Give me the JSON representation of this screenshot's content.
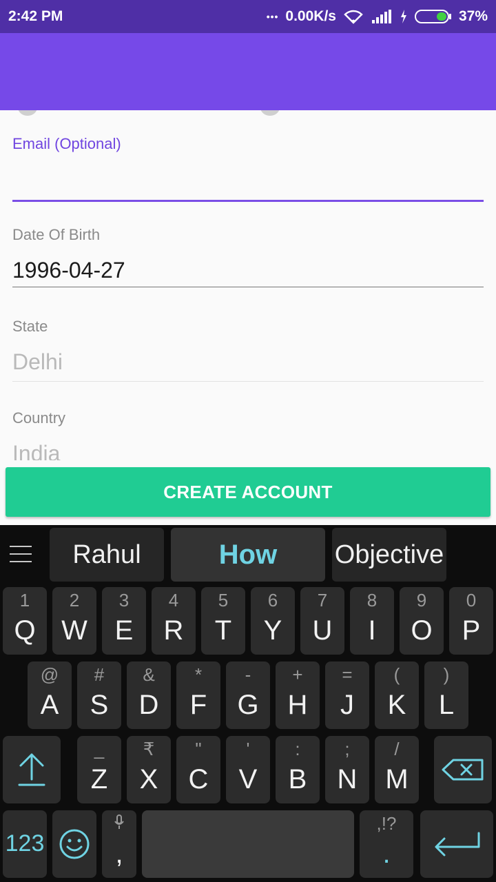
{
  "status_bar": {
    "time": "2:42 PM",
    "dots": "•••",
    "network_speed": "0.00K/s",
    "battery": "37%",
    "colors": {
      "background": "#4f2fa6"
    }
  },
  "app_bar": {
    "color": "#7649e8"
  },
  "form": {
    "email": {
      "label": "Email (Optional)",
      "value": ""
    },
    "dob": {
      "label": "Date Of Birth",
      "value": "1996-04-27"
    },
    "state": {
      "label": "State",
      "value": "Delhi"
    },
    "country": {
      "label": "Country",
      "value": "India"
    }
  },
  "create_button": {
    "label": "CREATE ACCOUNT",
    "color": "#20cc93"
  },
  "keyboard": {
    "suggestions": [
      "Rahul",
      "How",
      "Objective"
    ],
    "row1": [
      {
        "sub": "1",
        "main": "Q"
      },
      {
        "sub": "2",
        "main": "W"
      },
      {
        "sub": "3",
        "main": "E"
      },
      {
        "sub": "4",
        "main": "R"
      },
      {
        "sub": "5",
        "main": "T"
      },
      {
        "sub": "6",
        "main": "Y"
      },
      {
        "sub": "7",
        "main": "U"
      },
      {
        "sub": "8",
        "main": "I"
      },
      {
        "sub": "9",
        "main": "O"
      },
      {
        "sub": "0",
        "main": "P"
      }
    ],
    "row2": [
      {
        "sub": "@",
        "main": "A"
      },
      {
        "sub": "#",
        "main": "S"
      },
      {
        "sub": "&",
        "main": "D"
      },
      {
        "sub": "*",
        "main": "F"
      },
      {
        "sub": "-",
        "main": "G"
      },
      {
        "sub": "+",
        "main": "H"
      },
      {
        "sub": "=",
        "main": "J"
      },
      {
        "sub": "(",
        "main": "K"
      },
      {
        "sub": ")",
        "main": "L"
      }
    ],
    "row3": [
      {
        "sub": "_",
        "main": "Z"
      },
      {
        "sub": "₹",
        "main": "X"
      },
      {
        "sub": "\"",
        "main": "C"
      },
      {
        "sub": "'",
        "main": "V"
      },
      {
        "sub": ":",
        "main": "B"
      },
      {
        "sub": ";",
        "main": "N"
      },
      {
        "sub": "/",
        "main": "M"
      }
    ],
    "row4": {
      "numbers_label": "123",
      "comma": ",",
      "punct_sub": ",!?",
      "period": "."
    },
    "accent_color": "#6fd3e3"
  }
}
